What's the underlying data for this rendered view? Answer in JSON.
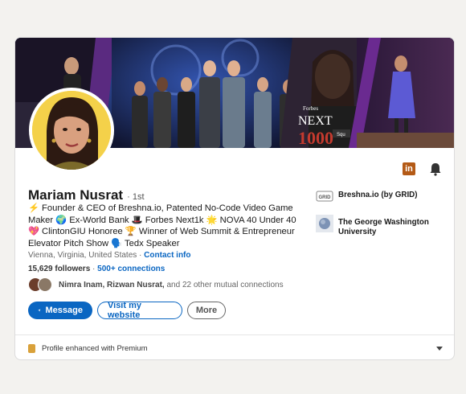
{
  "banner": {
    "overlay_brand": "Forbes",
    "overlay_big": "NEXT",
    "overlay_number": "1000",
    "overlay_tag": "Squ"
  },
  "profile": {
    "name": "Mariam Nusrat",
    "degree": "· 1st",
    "headline": "⚡ Founder & CEO of Breshna.io, Patented No-Code Video Game Maker 🌍 Ex-World Bank 🎩 Forbes Next1k 🌟 NOVA 40 Under 40 💖 ClintonGIU Honoree 🏆 Winner of Web Summit & Entrepreneur Elevator Pitch Show 🗣️ Tedx Speaker",
    "location": "Vienna, Virginia, United States",
    "separator": " · ",
    "contact_info": "Contact info",
    "followers": "15,629 followers",
    "connections": "500+ connections",
    "mutual_names": "Nimra Inam, Rizwan Nusrat,",
    "mutual_rest": " and 22 other mutual connections"
  },
  "actions": {
    "message": "Message",
    "visit_website": "Visit my website",
    "more": "More"
  },
  "organizations": [
    {
      "name": "Breshna.io (by GRID)",
      "logo_text": "GRID"
    },
    {
      "name": "The George Washington University"
    }
  ],
  "footer": {
    "text": "Profile enhanced with Premium"
  },
  "colors": {
    "accent": "#0a66c2",
    "linkedin_icon": "#b45a16",
    "premium": "#d9a13a"
  },
  "icons": [
    "linkedin-icon",
    "bell-icon",
    "send-icon",
    "premium-icon",
    "chevron-down-icon"
  ]
}
